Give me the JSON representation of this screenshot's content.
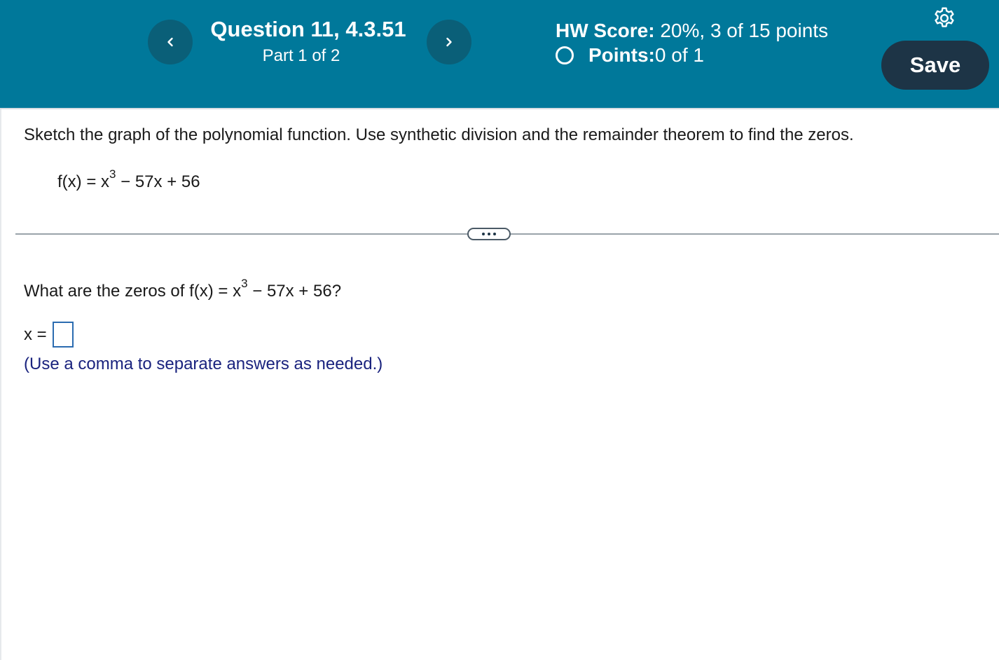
{
  "header": {
    "question_title": "Question 11, 4.3.51",
    "part": "Part 1 of 2",
    "hw_score_label": "HW Score:",
    "hw_score_value": " 20%, 3 of 15 points",
    "points_label": "Points:",
    "points_value": " 0 of 1",
    "save_label": "Save",
    "prev_icon": "chevron-left-icon",
    "next_icon": "chevron-right-icon",
    "settings_icon": "gear-icon",
    "accent_color": "#00789a"
  },
  "problem": {
    "instructions": "Sketch the graph of the polynomial function. Use synthetic division and the remainder theorem to find the zeros.",
    "func_lhs": "f(x) = x",
    "func_exp": "3",
    "func_rhs": " − 57x + 56"
  },
  "question": {
    "prefix": "What are the zeros of f(x) = x",
    "exp": "3",
    "suffix": " − 57x + 56?",
    "answer_label": "x =",
    "answer_value": "",
    "hint": "(Use a comma to separate answers as needed.)"
  }
}
